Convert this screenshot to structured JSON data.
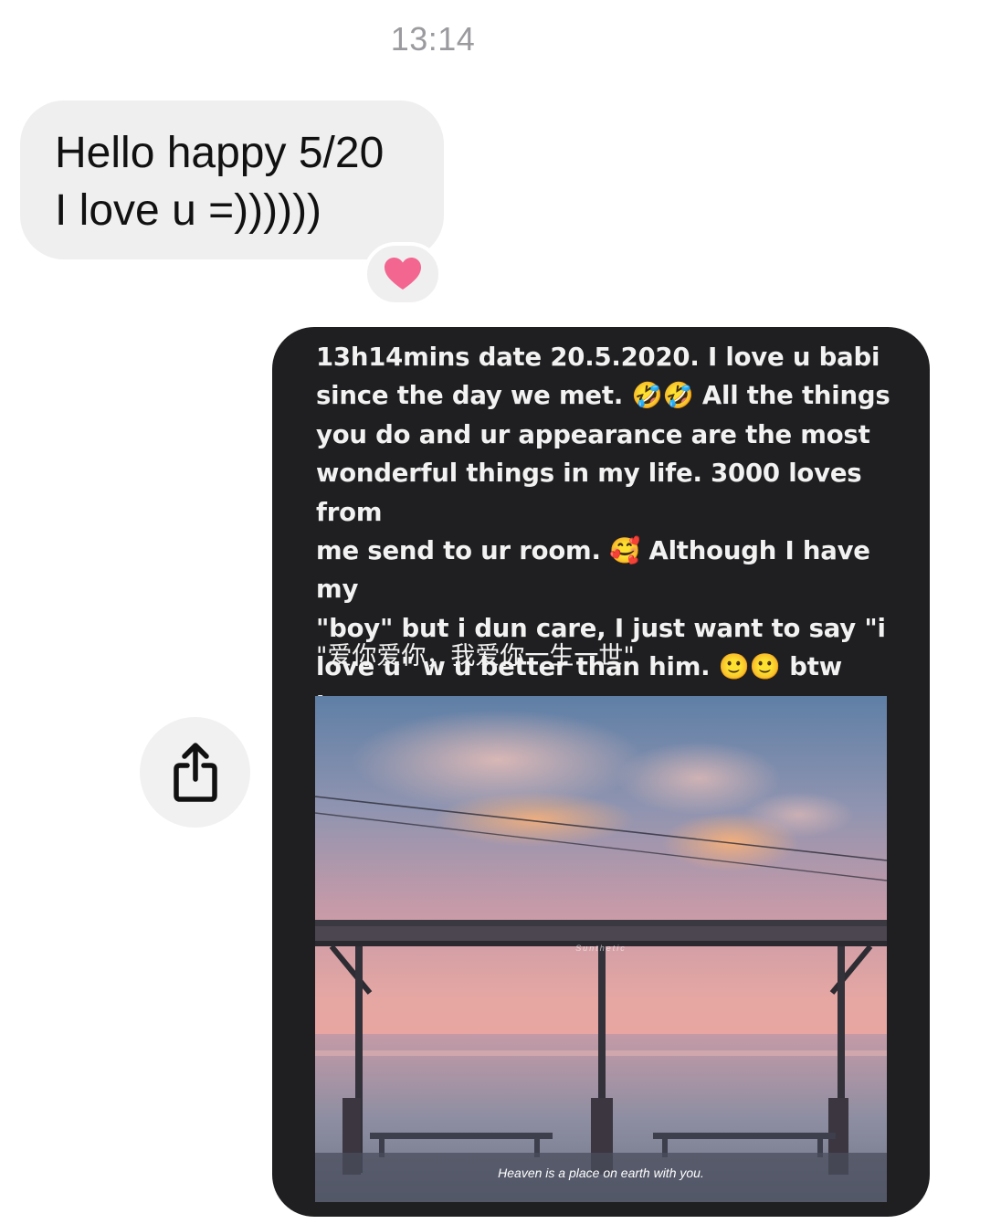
{
  "thread": {
    "timestamp": "13:14"
  },
  "incoming_message": {
    "lines": [
      "Hello happy 5/20",
      "I love u =))))))"
    ],
    "reaction": "heart-icon",
    "reaction_color": "#f2668f"
  },
  "shared_story": {
    "text": "13h14mins date 20.5.2020. I love u babi\nsince the day we met. 🤣🤣 All the things\nyou do and ur appearance are the most\nwonderful things in my life. 3000 loves from\nme send to ur room. 🥰 Although I have my\n\"boy\" but i dun care, I just want to say \"i\nlove u\" w u better than him. 🙂🙂 btw love\nu more than yst less than tmr. 🤪🤪",
    "chinese_line": "\"爱你爱你，我爱你一生一世\"",
    "photo_watermark": "Sunthetic",
    "photo_caption": "Heaven is a place on earth with you.",
    "background_color": "#1f1f21"
  },
  "share_button": {
    "icon": "share-icon"
  }
}
